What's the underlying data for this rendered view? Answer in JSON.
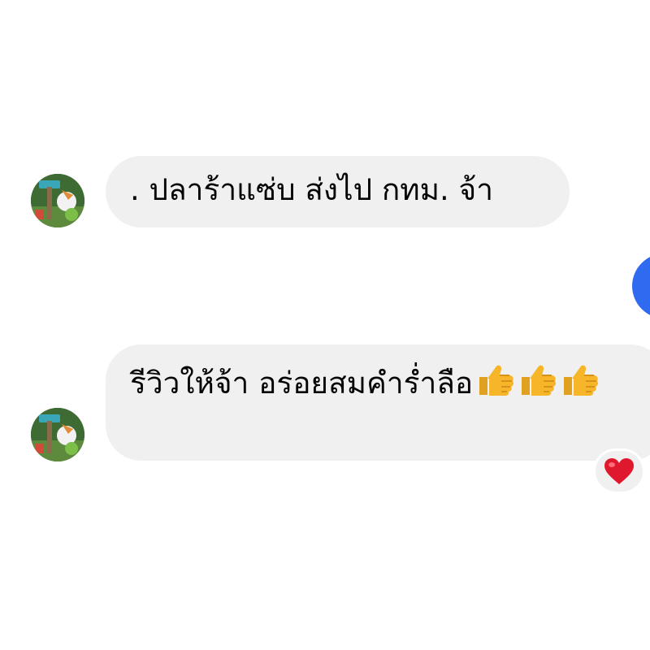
{
  "thread": {
    "messages": [
      {
        "direction": "incoming",
        "text": ". ปลาร้าแซ่บ ส่งไป กทม. จ้า"
      },
      {
        "direction": "incoming",
        "text": "รีวิวให้จ้า อร่อยสมคำร่ำลือ",
        "emojis": [
          "thumbs-up",
          "thumbs-up",
          "thumbs-up"
        ],
        "reaction": "heart"
      }
    ],
    "outgoing_bubble": {
      "direction": "outgoing",
      "text": ""
    }
  },
  "colors": {
    "incoming_bubble": "#f0f0f0",
    "outgoing_bubble": "#2f6bf0",
    "text": "#050505",
    "reaction_heart": "#e0182d",
    "emoji_thumb": "#f7b62a"
  },
  "icons": {
    "avatar": "profile-photo",
    "emoji": "thumbs-up-icon",
    "reaction": "heart-icon"
  }
}
